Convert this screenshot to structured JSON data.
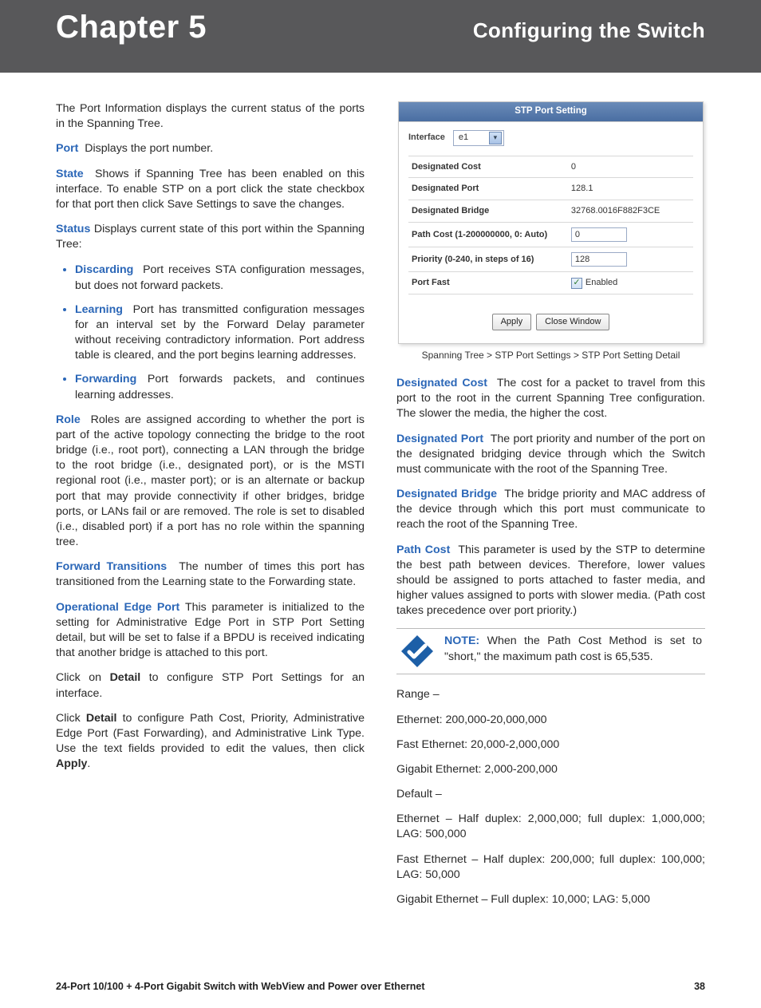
{
  "header": {
    "chapter": "Chapter 5",
    "subtitle": "Configuring the Switch"
  },
  "left": {
    "intro": "The Port Information displays the current status of the ports in the Spanning Tree.",
    "port": {
      "term": "Port",
      "text": "Displays the port number."
    },
    "state": {
      "term": "State",
      "text": "Shows if Spanning Tree has been enabled on this interface. To enable STP on a port click the state checkbox for that port then click Save Settings to save the changes."
    },
    "status": {
      "term": "Status",
      "text": "Displays current state of this port within the Spanning Tree:"
    },
    "bullets": {
      "discarding": {
        "term": "Discarding",
        "text": "Port receives STA configuration messages, but does not forward packets."
      },
      "learning": {
        "term": "Learning",
        "text": "Port has transmitted configuration messages for an interval set by the Forward Delay parameter without receiving contradictory information. Port address table is cleared, and the port begins learning addresses."
      },
      "forwarding": {
        "term": "Forwarding",
        "text": "Port forwards packets, and continues learning addresses."
      }
    },
    "role": {
      "term": "Role",
      "text": "Roles are assigned according to whether the port is part of the active topology connecting the bridge to the root bridge (i.e., root port), connecting a LAN through the bridge to the root bridge (i.e., designated port), or is the MSTI regional root (i.e., master port); or is an alternate or backup port that may provide connectivity if other bridges, bridge ports, or LANs fail or are removed. The role is set to disabled (i.e., disabled port) if a port has no role within the spanning tree."
    },
    "forward_transitions": {
      "term": "Forward Transitions",
      "text": "The number of times this port has transitioned from the Learning state to the Forwarding state."
    },
    "oper_edge": {
      "term": "Operational Edge Port",
      "text": "This parameter is initialized to the setting for Administrative Edge Port in STP Port Setting detail, but will be set to false if a BPDU is received indicating that another bridge is attached to this port."
    },
    "click_detail_1a": "Click on ",
    "click_detail_1b": "Detail",
    "click_detail_1c": " to configure STP Port Settings for an interface.",
    "click_detail_2a": "Click ",
    "click_detail_2b": "Detail",
    "click_detail_2c": " to configure Path Cost, Priority, Administrative Edge Port (Fast Forwarding), and Administrative Link Type. Use the text fields provided to edit the values, then click ",
    "click_detail_2d": "Apply",
    "click_detail_2e": "."
  },
  "dialog": {
    "title": "STP Port Setting",
    "interface_label": "Interface",
    "interface_value": "e1",
    "rows": {
      "designated_cost": {
        "label": "Designated Cost",
        "value": "0"
      },
      "designated_port": {
        "label": "Designated Port",
        "value": "128.1"
      },
      "designated_bridge": {
        "label": "Designated Bridge",
        "value": "32768.0016F882F3CE"
      },
      "path_cost": {
        "label": "Path Cost (1-200000000, 0: Auto)",
        "value": "0"
      },
      "priority": {
        "label": "Priority (0-240, in steps of 16)",
        "value": "128"
      },
      "port_fast": {
        "label": "Port Fast",
        "checkbox": "Enabled"
      }
    },
    "buttons": {
      "apply": "Apply",
      "close": "Close Window"
    },
    "caption": "Spanning Tree > STP Port Settings > STP Port Setting Detail"
  },
  "right": {
    "designated_cost": {
      "term": "Designated Cost",
      "text": "The cost for a packet to travel from this port to the root in the current Spanning Tree configuration. The slower the media, the higher the cost."
    },
    "designated_port": {
      "term": "Designated Port",
      "text": "The port priority and number of the port on the designated bridging device through which the Switch must communicate with the root of the Spanning Tree."
    },
    "designated_bridge": {
      "term": "Designated Bridge",
      "text": "The bridge priority and MAC address of the device through which this port must communicate to reach the root of the Spanning Tree."
    },
    "path_cost": {
      "term": "Path Cost",
      "text": "This parameter is used by the STP to determine the best path between devices. Therefore, lower values should be assigned to ports attached to faster media, and higher values assigned to ports with slower media. (Path cost takes precedence over port priority.)"
    },
    "note": {
      "label": "NOTE:",
      "text": "When the Path Cost Method is set to \"short,\" the maximum path cost is 65,535."
    },
    "range_label": "Range –",
    "ranges": {
      "ethernet": "Ethernet: 200,000-20,000,000",
      "fast_ethernet": "Fast Ethernet: 20,000-2,000,000",
      "gigabit": "Gigabit Ethernet: 2,000-200,000"
    },
    "default_label": "Default –",
    "defaults": {
      "ethernet": "Ethernet – Half duplex: 2,000,000; full duplex: 1,000,000; LAG: 500,000",
      "fast_ethernet": "Fast Ethernet – Half duplex: 200,000; full duplex: 100,000; LAG: 50,000",
      "gigabit": "Gigabit Ethernet – Full duplex: 10,000; LAG: 5,000"
    }
  },
  "footer": {
    "left": "24-Port 10/100 + 4-Port Gigabit Switch with WebView and Power over Ethernet",
    "page": "38"
  }
}
